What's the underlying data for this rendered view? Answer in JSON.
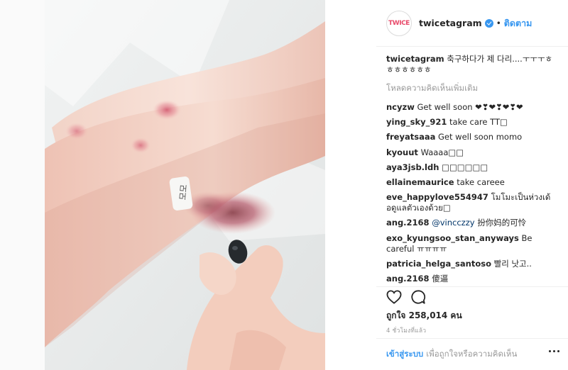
{
  "header": {
    "username": "twicetagram",
    "dot": "•",
    "follow_label": "ติดตาม",
    "avatar_text": "TWICE"
  },
  "caption": {
    "username": "twicetagram",
    "text": "축구하다가 제 다리....ㅜㅜㅜㅎㅎㅎㅎㅎㅎㅎ"
  },
  "load_more": "โหลดความคิดเห็นเพิ่มเติม",
  "comments": [
    {
      "user": "ncyzw",
      "text": "Get well soon ❤❣❤❣❤❣❤"
    },
    {
      "user": "ying_sky_921",
      "text": "take care TT□"
    },
    {
      "user": "freyatsaaa",
      "text": "Get well soon momo"
    },
    {
      "user": "kyouut",
      "text": "Waaaa□□"
    },
    {
      "user": "aya3jsb.ldh",
      "text": "□□□□□□"
    },
    {
      "user": "ellainemaurice",
      "text": "take careee"
    },
    {
      "user": "eve_happylove554947",
      "text": "โมโมะเป็นห่วงเด้อดูแลตัวเองด้วย□"
    },
    {
      "user": "ang.2168",
      "mention": "@vincczzy",
      "text": "扮你妈的可怜"
    },
    {
      "user": "exo_kyungsoo_stan_anyways",
      "text": "Be careful ㅠㅠㅠㅠ"
    },
    {
      "user": "patricia_helga_santoso",
      "text": "빨리 낫고.."
    },
    {
      "user": "ang.2168",
      "text": "傻逼"
    }
  ],
  "likes": "ถูกใจ 258,014 คน",
  "time": "4 ชั่วโมงที่แล้ว",
  "footer": {
    "login_label": "เข้าสู่ระบบ",
    "rest_text": "เพื่อถูกใจหรือความคิดเห็น"
  },
  "photo": {
    "label_text": "모모"
  },
  "colors": {
    "accent": "#3897f0",
    "text": "#262626",
    "muted": "#999999"
  },
  "icons": [
    "heart-icon",
    "comment-icon",
    "verified-icon",
    "more-options-icon"
  ]
}
